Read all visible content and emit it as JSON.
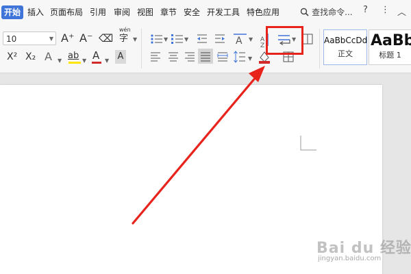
{
  "menu": {
    "tabs": [
      "开始",
      "插入",
      "页面布局",
      "引用",
      "审阅",
      "视图",
      "章节",
      "安全",
      "开发工具",
      "特色应用"
    ],
    "search_label": "查找命令...",
    "help": "?",
    "more": "⋮",
    "collapse": "︿"
  },
  "ribbon": {
    "font_size": "10",
    "increase_font": "A⁺",
    "decrease_font": "A⁻",
    "eraser_glyph": "⌫",
    "pinyin_char": "字",
    "pinyin_top": "wén",
    "superscript": "X²",
    "subscript": "X₂",
    "font_effect": "A",
    "highlight": "ab",
    "font_color": "A",
    "char_shading": "A"
  },
  "styles": [
    {
      "sample": "AaBbCcDd",
      "name": "正文"
    },
    {
      "sample": "AaBb",
      "name": "标题 1"
    }
  ],
  "colors": {
    "active_tab": "#3f74d8",
    "annotation_red": "#e8231b",
    "font_color_bar": "#d22a2a",
    "highlight_bar": "#ffe600"
  },
  "watermark": {
    "logo": "Bai du 经验",
    "url": "jingyan.baidu.com"
  }
}
